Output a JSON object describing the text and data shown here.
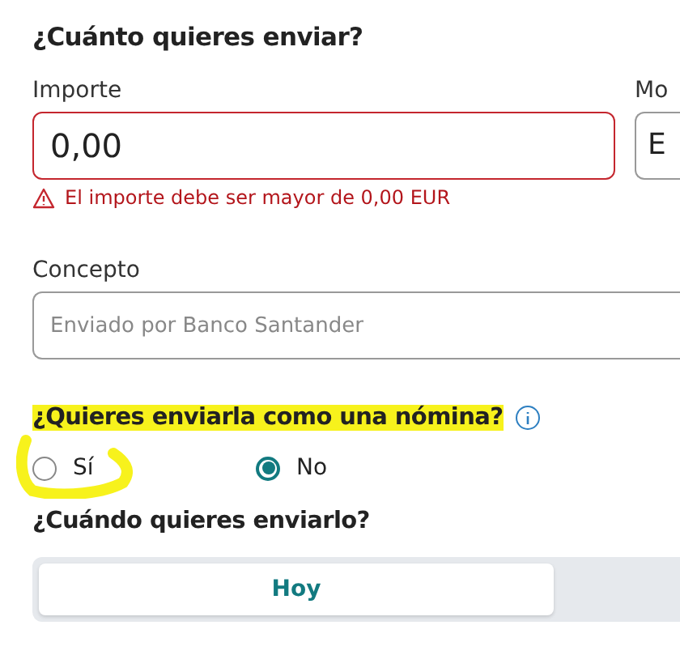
{
  "amount_section": {
    "title": "¿Cuánto quieres enviar?",
    "amount": {
      "label": "Importe",
      "value": "0,00",
      "error": "El importe debe ser mayor de 0,00 EUR"
    },
    "currency": {
      "label": "Mo",
      "value": "E"
    }
  },
  "concept": {
    "label": "Concepto",
    "placeholder": "Enviado por Banco Santander"
  },
  "payroll": {
    "question": "¿Quieres enviarla como una nómina?",
    "highlighted": true,
    "options": [
      {
        "label": "Sí",
        "selected": false,
        "circled": true
      },
      {
        "label": "No",
        "selected": true,
        "circled": false
      }
    ]
  },
  "when": {
    "title": "¿Cuándo quieres enviarlo?",
    "tabs": [
      {
        "label": "Hoy",
        "selected": true
      }
    ]
  }
}
